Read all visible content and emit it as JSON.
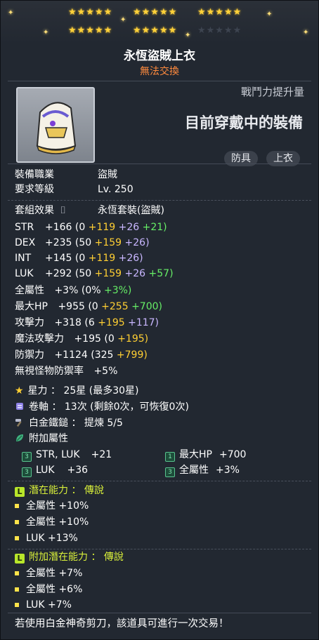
{
  "item": {
    "name": "永恆盜賊上衣",
    "trade_status": "無法交換",
    "combat_power_label": "戰鬥力提升量",
    "equipped_label": "目前穿戴中的裝備",
    "tags": [
      "防具",
      "上衣"
    ]
  },
  "requirements": [
    {
      "label": "裝備職業",
      "value": "盜賊"
    },
    {
      "label": "要求等級",
      "value": "Lv. 250"
    }
  ],
  "set_effect": {
    "label": "套組效果",
    "value": "永恆套裝(盜賊)"
  },
  "stats": [
    {
      "name": "STR",
      "total": "+166",
      "base": "(0",
      "flame": "+119",
      "enhance": "+26",
      "star": "+21)"
    },
    {
      "name": "DEX",
      "total": "+235",
      "base": "(50",
      "flame": "+159",
      "enhance": "+26)",
      "star": ""
    },
    {
      "name": "INT",
      "total": "+145",
      "base": "(0",
      "flame": "+119",
      "enhance": "+26)",
      "star": ""
    },
    {
      "name": "LUK",
      "total": "+292",
      "base": "(50",
      "flame": "+159",
      "enhance": "+26",
      "star": "+57)"
    }
  ],
  "stats2": {
    "all_stat": {
      "name": "全屬性",
      "total": "+3%",
      "base": "(0%",
      "star": "+3%)"
    },
    "max_hp": {
      "name": "最大HP",
      "total": "+955",
      "base": "(0",
      "flame": "+255",
      "star": "+700)"
    },
    "attack": {
      "name": "攻擊力",
      "total": "+318",
      "base": "(6",
      "flame": "+195",
      "enhance": "+117)"
    },
    "magic": {
      "name": "魔法攻擊力",
      "total": "+195",
      "base": "(0",
      "flame": "+195)"
    },
    "defense": {
      "name": "防禦力",
      "total": "+1124",
      "base": "(325",
      "flame": "+799)"
    },
    "ignore_def": {
      "name": "無視怪物防禦率",
      "total": "+5%"
    }
  },
  "upgrades": {
    "star_force": "星力 ： 25星 (最多30星)",
    "scrolls": "卷軸 ： 13次 (剩餘0次，可恢復0次)",
    "hammer": "白金鐵鎚 ： 提煉 5/5"
  },
  "bonus_header": "附加屬性",
  "bonus": [
    {
      "label": "STR, LUK",
      "value": "+21",
      "badge": "3"
    },
    {
      "label": "最大HP",
      "value": "+700",
      "badge": "1"
    },
    {
      "label": "LUK",
      "value": "+36",
      "badge": "3"
    },
    {
      "label": "全屬性",
      "value": "+3%",
      "badge": "3"
    }
  ],
  "potential": {
    "header": "潛在能力 ： 傳說",
    "lines": [
      "全屬性 +10%",
      "全屬性 +10%",
      "LUK +13%"
    ]
  },
  "additional_potential": {
    "header": "附加潛在能力 ： 傳說",
    "lines": [
      "全屬性 +7%",
      "全屬性 +6%",
      "LUK +7%"
    ]
  },
  "footer": "若使用白金神奇剪刀，該道具可進行一次交易！",
  "colors": {
    "yellow": "#ffcf33",
    "green": "#66ee66",
    "purple": "#c9b7ff",
    "orange": "#ff8a3d"
  }
}
